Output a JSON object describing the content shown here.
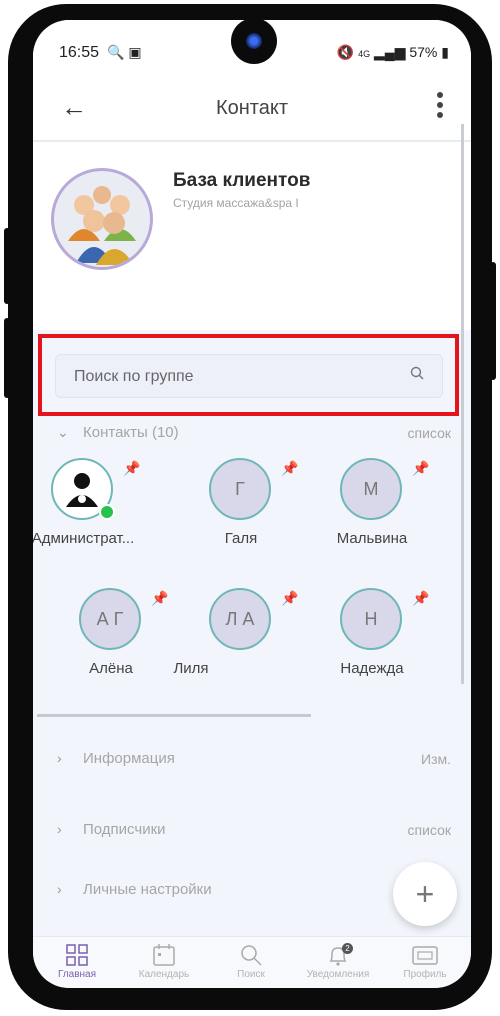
{
  "status_bar": {
    "time": "16:55",
    "battery": "57%",
    "network": "4G"
  },
  "appbar": {
    "title": "Контакт"
  },
  "group": {
    "name": "База клиентов",
    "subtitle": "Студия массажа&spa I"
  },
  "search": {
    "placeholder": "Поиск по группе"
  },
  "contacts_section": {
    "label": "Контакты (10)",
    "action": "список"
  },
  "contacts": [
    {
      "initials": "",
      "name": "Администрат...",
      "online": true,
      "icon": "admin-user-icon"
    },
    {
      "initials": "Г",
      "name": "Галя"
    },
    {
      "initials": "М",
      "name": "Мальвина"
    },
    {
      "initials": "А Г",
      "name": "Алёна"
    },
    {
      "initials": "Л А",
      "name": "Лиля"
    },
    {
      "initials": "Н",
      "name": "Надежда"
    }
  ],
  "sections": [
    {
      "label": "Информация",
      "action": "Изм."
    },
    {
      "label": "Подписчики",
      "action": "список"
    },
    {
      "label": "Личные настройки",
      "action": ""
    }
  ],
  "bottom_nav": [
    {
      "label": "Главная",
      "icon": "home-grid-icon",
      "active": true
    },
    {
      "label": "Календарь",
      "icon": "calendar-icon"
    },
    {
      "label": "Поиск",
      "icon": "search-icon"
    },
    {
      "label": "Уведомления",
      "icon": "bell-icon",
      "badge": "2"
    },
    {
      "label": "Профиль",
      "icon": "profile-card-icon"
    }
  ],
  "colors": {
    "accent": "#7a5fb0",
    "highlight_border": "#e3141b",
    "online": "#27c24c"
  }
}
